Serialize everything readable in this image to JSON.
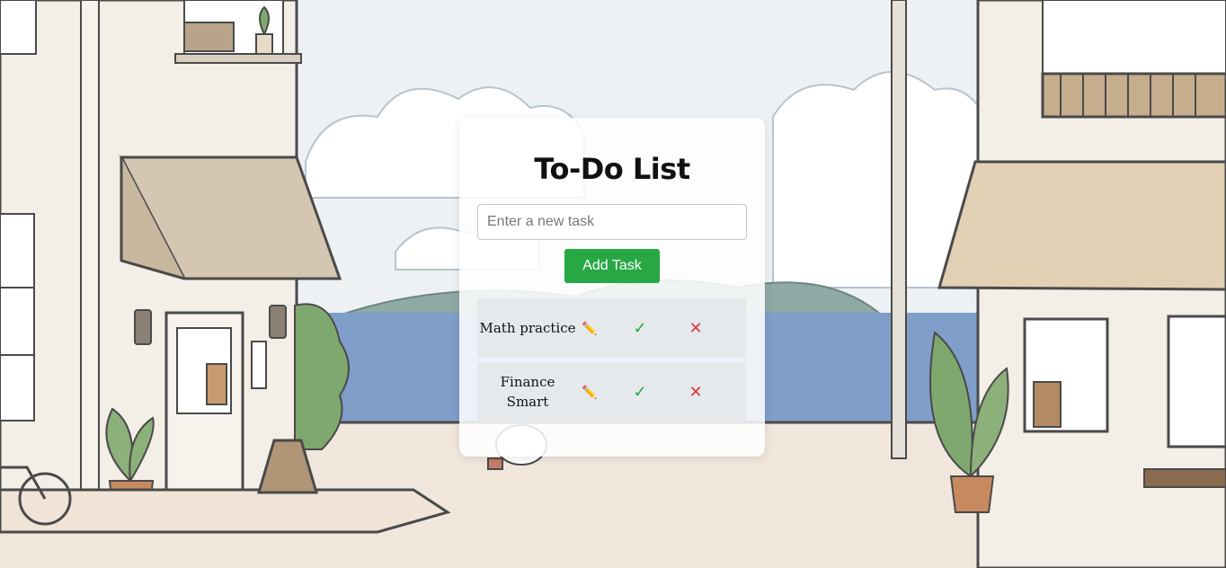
{
  "app": {
    "title": "To-Do List"
  },
  "input": {
    "placeholder": "Enter a new task",
    "value": ""
  },
  "add_button": {
    "label": "Add Task"
  },
  "tasks": [
    {
      "text": "Math practice",
      "edit_icon": "✏️",
      "done_icon": "✓",
      "delete_icon": "✕"
    },
    {
      "text": "Finance Smart",
      "edit_icon": "✏️",
      "done_icon": "✓",
      "delete_icon": "✕"
    }
  ],
  "colors": {
    "add_button": "#28a745",
    "done": "#28a745",
    "delete": "#dc3545",
    "row_bg": "#e6e9ec"
  },
  "icons": {
    "edit": "pencil-icon",
    "done": "checkmark-icon",
    "delete": "close-icon"
  }
}
